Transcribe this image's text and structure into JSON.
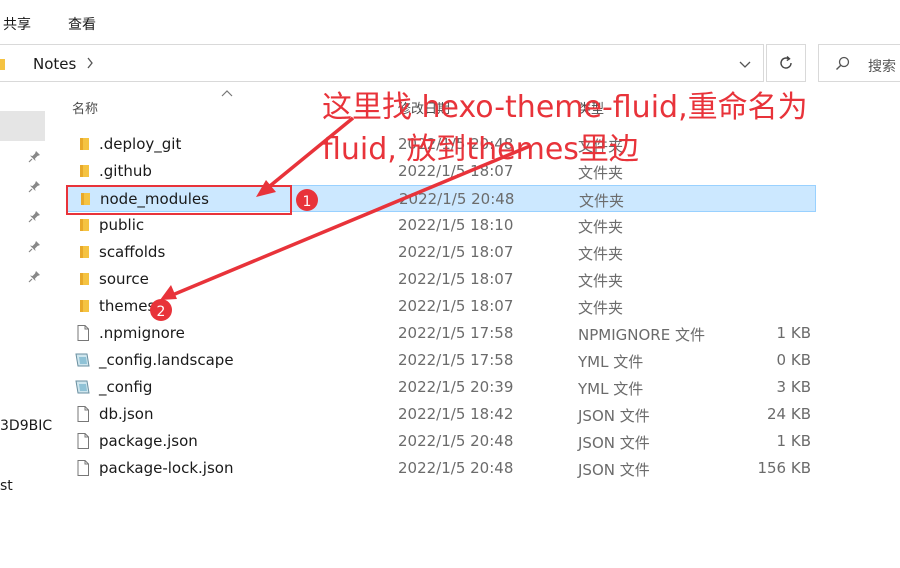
{
  "ribbon": {
    "tabs": [
      "共享",
      "查看"
    ]
  },
  "address": {
    "breadcrumb": "Notes",
    "search_placeholder": "搜索"
  },
  "nav": {
    "partial_items": [
      "3D9BIC",
      "st"
    ]
  },
  "columns": {
    "name": "名称",
    "date": "修改日期",
    "type": "类型"
  },
  "files": [
    {
      "name": ".deploy_git",
      "date": "2022/1/5 20:48",
      "type": "文件夹",
      "size": "",
      "icon": "folder-icon"
    },
    {
      "name": ".github",
      "date": "2022/1/5 18:07",
      "type": "文件夹",
      "size": "",
      "icon": "folder-icon"
    },
    {
      "name": "node_modules",
      "date": "2022/1/5 20:48",
      "type": "文件夹",
      "size": "",
      "icon": "folder-icon"
    },
    {
      "name": "public",
      "date": "2022/1/5 18:10",
      "type": "文件夹",
      "size": "",
      "icon": "folder-icon"
    },
    {
      "name": "scaffolds",
      "date": "2022/1/5 18:07",
      "type": "文件夹",
      "size": "",
      "icon": "folder-icon"
    },
    {
      "name": "source",
      "date": "2022/1/5 18:07",
      "type": "文件夹",
      "size": "",
      "icon": "folder-icon"
    },
    {
      "name": "themes",
      "date": "2022/1/5 18:07",
      "type": "文件夹",
      "size": "",
      "icon": "folder-icon"
    },
    {
      "name": ".npmignore",
      "date": "2022/1/5 17:58",
      "type": "NPMIGNORE 文件",
      "size": "1 KB",
      "icon": "file-icon"
    },
    {
      "name": "_config.landscape",
      "date": "2022/1/5 17:58",
      "type": "YML 文件",
      "size": "0 KB",
      "icon": "yml-file-icon"
    },
    {
      "name": "_config",
      "date": "2022/1/5 20:39",
      "type": "YML 文件",
      "size": "3 KB",
      "icon": "yml-file-icon"
    },
    {
      "name": "db.json",
      "date": "2022/1/5 18:42",
      "type": "JSON 文件",
      "size": "24 KB",
      "icon": "file-icon"
    },
    {
      "name": "package.json",
      "date": "2022/1/5 20:48",
      "type": "JSON 文件",
      "size": "1 KB",
      "icon": "file-icon"
    },
    {
      "name": "package-lock.json",
      "date": "2022/1/5 20:48",
      "type": "JSON 文件",
      "size": "156 KB",
      "icon": "file-icon"
    }
  ],
  "selected_row": "node_modules",
  "annotation": {
    "line1": "这里找 hexo-theme-fluid,重命名为",
    "line2": "fluid, 放到themes里边",
    "marker1": "1",
    "marker2": "2",
    "color": "#e8333a"
  },
  "colors": {
    "selection": "#cce8ff",
    "selection_border": "#99d1ff",
    "folder": "#f5c342"
  }
}
